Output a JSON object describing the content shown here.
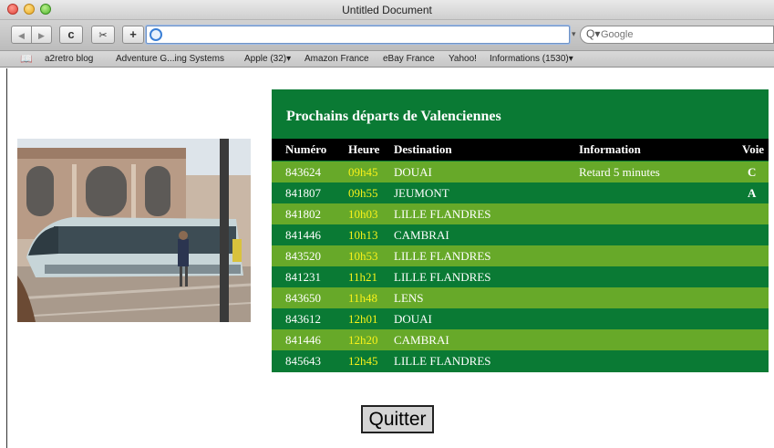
{
  "window": {
    "title": "Untitled Document"
  },
  "toolbar": {
    "back_icon": "◀",
    "forward_icon": "▶",
    "reload_icon": "c",
    "snap_icon": "✂",
    "add_icon": "+",
    "url_value": "",
    "search_placeholder": "Google"
  },
  "bookmarks": [
    "a2retro blog",
    "Adventure G...ing Systems",
    "Apple (32)▾",
    "Amazon France",
    "eBay France",
    "Yahoo!",
    "Informations (1530)▾"
  ],
  "board": {
    "title": "Prochains départs de Valenciennes",
    "headers": {
      "number": "Numéro",
      "time": "Heure",
      "destination": "Destination",
      "information": "Information",
      "platform": "Voie"
    },
    "rows": [
      {
        "number": "843624",
        "time": "09h45",
        "destination": "DOUAI",
        "information": "Retard 5 minutes",
        "platform": "C"
      },
      {
        "number": "841807",
        "time": "09h55",
        "destination": "JEUMONT",
        "information": "",
        "platform": "A"
      },
      {
        "number": "841802",
        "time": "10h03",
        "destination": "LILLE FLANDRES",
        "information": "",
        "platform": ""
      },
      {
        "number": "841446",
        "time": "10h13",
        "destination": "CAMBRAI",
        "information": "",
        "platform": ""
      },
      {
        "number": "843520",
        "time": "10h53",
        "destination": "LILLE FLANDRES",
        "information": "",
        "platform": ""
      },
      {
        "number": "841231",
        "time": "11h21",
        "destination": "LILLE FLANDRES",
        "information": "",
        "platform": ""
      },
      {
        "number": "843650",
        "time": "11h48",
        "destination": "LENS",
        "information": "",
        "platform": ""
      },
      {
        "number": "843612",
        "time": "12h01",
        "destination": "DOUAI",
        "information": "",
        "platform": ""
      },
      {
        "number": "841446",
        "time": "12h20",
        "destination": "CAMBRAI",
        "information": "",
        "platform": ""
      },
      {
        "number": "845643",
        "time": "12h45",
        "destination": "LILLE FLANDRES",
        "information": "",
        "platform": ""
      }
    ]
  },
  "quit_button": {
    "label": "Quitter"
  },
  "colors": {
    "board_dark": "#0a7a34",
    "board_light": "#67a929",
    "time_yellow": "#f8f21a"
  }
}
